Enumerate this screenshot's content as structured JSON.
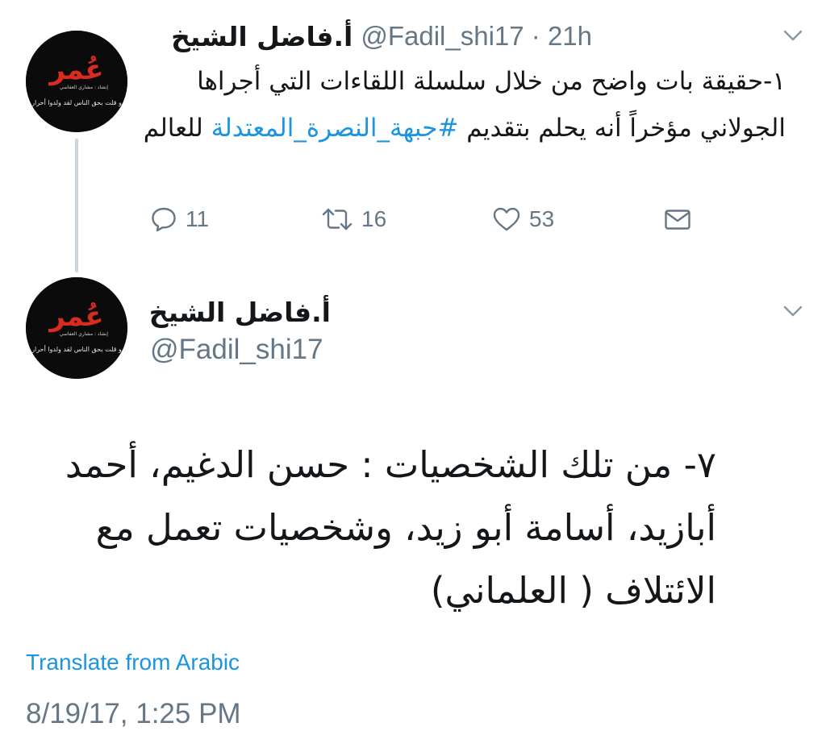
{
  "colors": {
    "text": "#14171a",
    "secondary": "#657786",
    "link": "#1b95e0",
    "thread_line": "#ccd6dd"
  },
  "tweet1": {
    "display_name": "أ.فاضل الشيخ",
    "meta": "@Fadil_shi17 · 21h",
    "text_before": "١-حقيقة بات واضح من خلال سلسلة اللقاءات التي أجراها الجولاني مؤخراً أنه يحلم بتقديم ",
    "hashtag": "#جبهة_النصرة_المعتدلة",
    "text_after": " للعالم",
    "actions": {
      "reply_icon": "reply-icon",
      "reply_count": "11",
      "retweet_icon": "retweet-icon",
      "retweet_count": "16",
      "like_icon": "heart-icon",
      "like_count": "53",
      "dm_icon": "envelope-icon"
    }
  },
  "tweet2": {
    "display_name": "أ.فاضل الشيخ",
    "handle": "@Fadil_shi17",
    "text": "٧- من تلك الشخصيات : حسن الدغيم، أحمد أبازيد، أسامة أبو زيد، وشخصيات تعمل مع الائتلاف ( العلماني)",
    "translate_label": "Translate from Arabic",
    "timestamp": "8/19/17, 1:25 PM"
  },
  "avatar": {
    "logo_text": "عُمر",
    "tagline": "و قلت بحق الناس لقد ولدوا أحرار",
    "sub_text": "إنشاد : مشاري العفاسي"
  }
}
